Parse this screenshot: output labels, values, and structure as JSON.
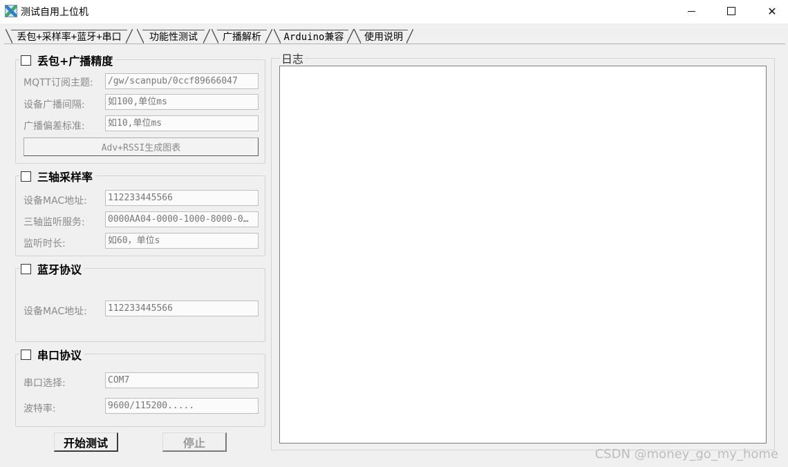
{
  "window": {
    "title": "测试自用上位机",
    "minimize": "minimize",
    "maximize": "maximize",
    "close": "✕"
  },
  "tabs": [
    {
      "label": "丢包+采样率+蓝牙+串口",
      "active": true
    },
    {
      "label": "功能性测试",
      "active": false
    },
    {
      "label": "广播解析",
      "active": false
    },
    {
      "label": "Arduino兼容",
      "active": false
    },
    {
      "label": "使用说明",
      "active": false
    }
  ],
  "groups": {
    "packet_loss": {
      "title": "丢包+广播精度",
      "checked": false,
      "fields": [
        {
          "label": "MQTT订阅主题:",
          "value": "/gw/scanpub/0ccf89666047",
          "placeholder": ""
        },
        {
          "label": "设备广播间隔:",
          "value": "",
          "placeholder": "如100,单位ms"
        },
        {
          "label": "广播偏差标准:",
          "value": "",
          "placeholder": "如10,单位ms"
        }
      ],
      "button": "Adv+RSSI生成图表"
    },
    "sampling": {
      "title": "三轴采样率",
      "checked": false,
      "fields": [
        {
          "label": "设备MAC地址:",
          "value": "112233445566",
          "placeholder": ""
        },
        {
          "label": "三轴监听服务:",
          "value": "0000AA04-0000-1000-8000-0…",
          "placeholder": ""
        },
        {
          "label": "监听时长:",
          "value": "",
          "placeholder": "如60，单位s"
        }
      ]
    },
    "bluetooth": {
      "title": "蓝牙协议",
      "checked": false,
      "fields": [
        {
          "label": "设备MAC地址:",
          "value": "112233445566",
          "placeholder": ""
        }
      ]
    },
    "serial": {
      "title": "串口协议",
      "checked": false,
      "fields": [
        {
          "label": "串口选择:",
          "value": "",
          "placeholder": "COM7"
        },
        {
          "label": "波特率:",
          "value": "",
          "placeholder": "9600/115200....."
        }
      ]
    }
  },
  "actions": {
    "start": "开始测试",
    "stop": "停止"
  },
  "log": {
    "title": "日志",
    "content": ""
  },
  "watermark": "CSDN @money_go_my_home"
}
